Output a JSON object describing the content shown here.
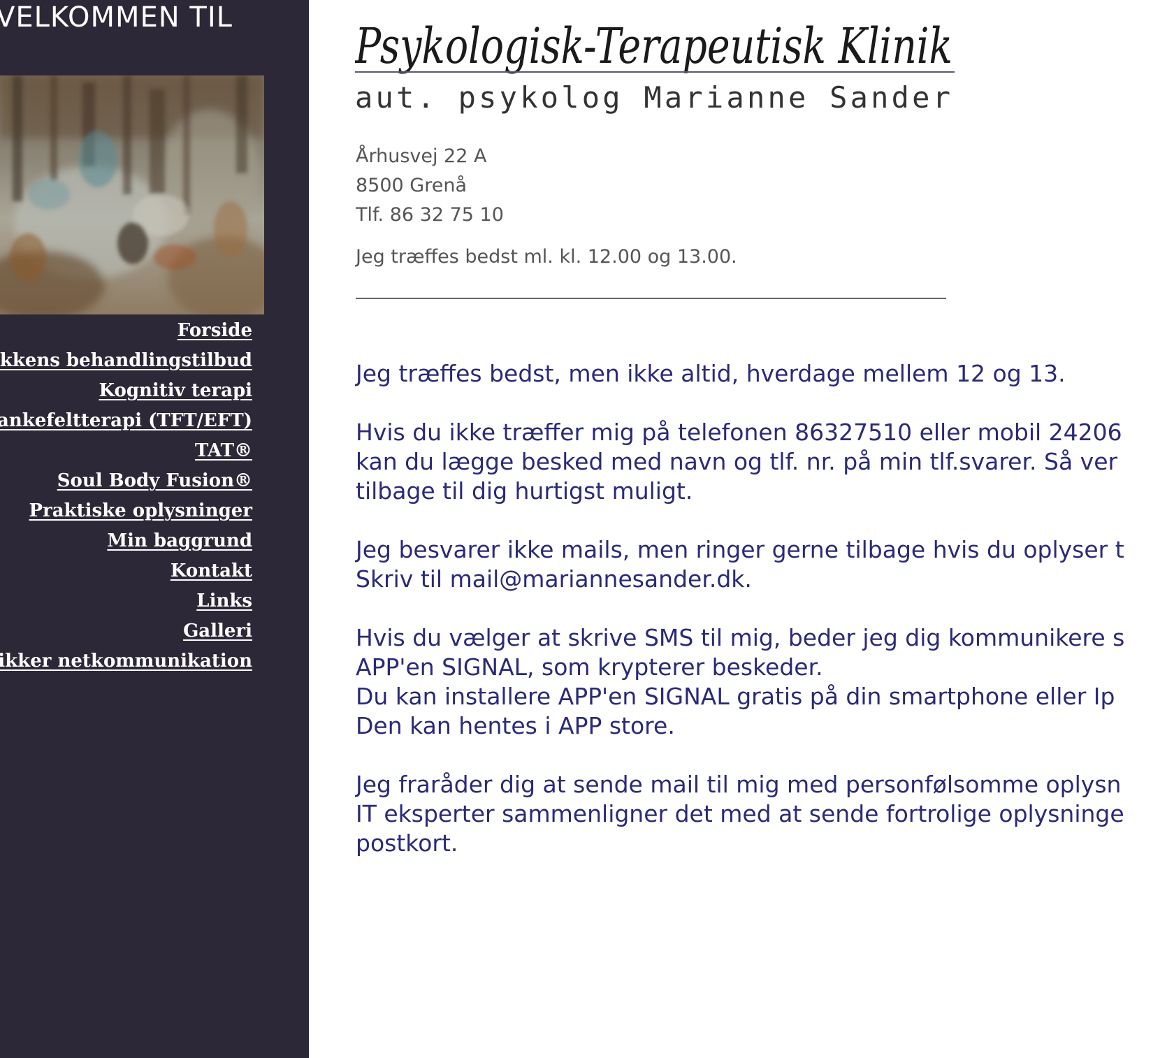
{
  "sidebar": {
    "welcome": "VELKOMMEN TIL",
    "nav": [
      {
        "label": "Forside"
      },
      {
        "label": "kkens behandlingstilbud"
      },
      {
        "label": "Kognitiv terapi"
      },
      {
        "label": "ankefeltterapi (TFT/EFT)"
      },
      {
        "label": "TAT®"
      },
      {
        "label": "Soul Body Fusion®"
      },
      {
        "label": "Praktiske oplysninger"
      },
      {
        "label": "Min baggrund"
      },
      {
        "label": "Kontakt"
      },
      {
        "label": "Links"
      },
      {
        "label": "Galleri"
      },
      {
        "label": "ikker netkommunikation"
      }
    ]
  },
  "header": {
    "logo_script": "Psykologisk-Terapeutisk Klinik",
    "subtitle": "aut. psykolog Marianne Sander"
  },
  "contact": {
    "street": "Århusvej 22 A",
    "city": "8500 Grenå",
    "phone": "Tlf. 86 32 75 10",
    "hours": "Jeg træffes bedst ml. kl. 12.00 og 13.00."
  },
  "content": {
    "p1": [
      "Jeg træffes bedst, men ikke altid, hverdage mellem 12 og 13."
    ],
    "p2": [
      "Hvis du ikke træffer mig på telefonen 86327510 eller mobil 24206",
      "kan du lægge besked med navn og tlf. nr. på min tlf.svarer. Så ver",
      "tilbage til dig hurtigst muligt."
    ],
    "p3": [
      "Jeg besvarer ikke mails, men ringer gerne tilbage hvis du oplyser t",
      "Skriv til mail@mariannesander.dk."
    ],
    "p4": [
      "Hvis du vælger at skrive SMS til mig, beder jeg dig kommunikere s",
      "APP'en SIGNAL, som krypterer beskeder.",
      "Du kan installere APP'en SIGNAL gratis på din smartphone eller Ip",
      "Den kan hentes i APP store."
    ],
    "p5": [
      "Jeg fraråder dig at sende mail til mig med personfølsomme oplysn",
      "IT eksperter sammenligner det med at sende fortrolige oplysninge",
      "postkort."
    ]
  },
  "colors": {
    "sidebar_bg": "#2c2838",
    "body_text": "#2a2a78",
    "logo_blue": "#3a3a8c"
  }
}
